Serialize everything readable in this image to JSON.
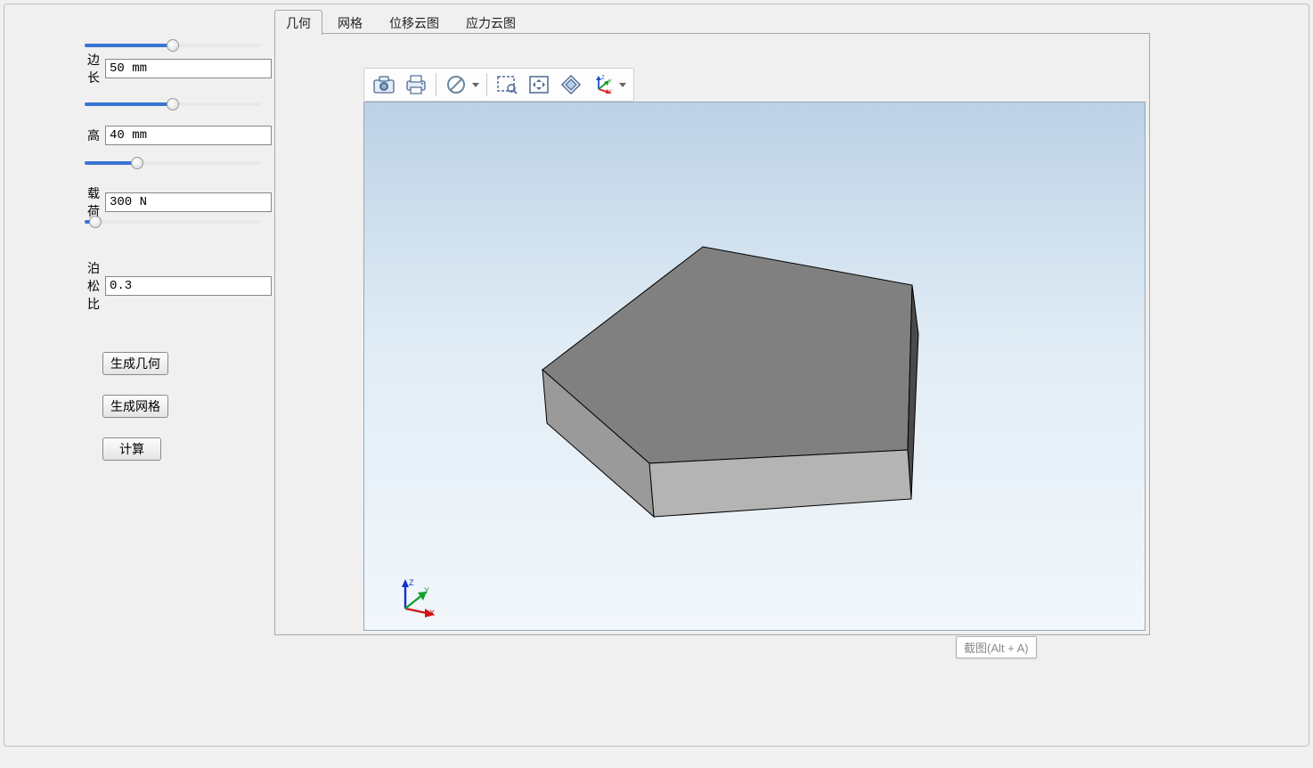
{
  "params": {
    "edge": {
      "label": "边长",
      "value": "50 mm",
      "slider_percent": 50
    },
    "height": {
      "label": "高",
      "value": "40 mm",
      "slider_percent": 50
    },
    "load": {
      "label": "载荷",
      "value": "300 N",
      "slider_percent": 30
    },
    "poisson": {
      "label": "泊松比",
      "value": "0.3",
      "slider_percent": 6
    }
  },
  "buttons": {
    "gen_geom": "生成几何",
    "gen_mesh": "生成网格",
    "compute": "计算"
  },
  "tabs": [
    "几何",
    "网格",
    "位移云图",
    "应力云图"
  ],
  "active_tab_index": 0,
  "toolbar_icons": [
    "camera",
    "printer",
    "no-entry",
    "zoom-box",
    "pan",
    "fit-all",
    "axis"
  ],
  "axis_labels": {
    "x": "X",
    "y": "Y",
    "z": "Z"
  },
  "tooltip": "截图(Alt + A)"
}
